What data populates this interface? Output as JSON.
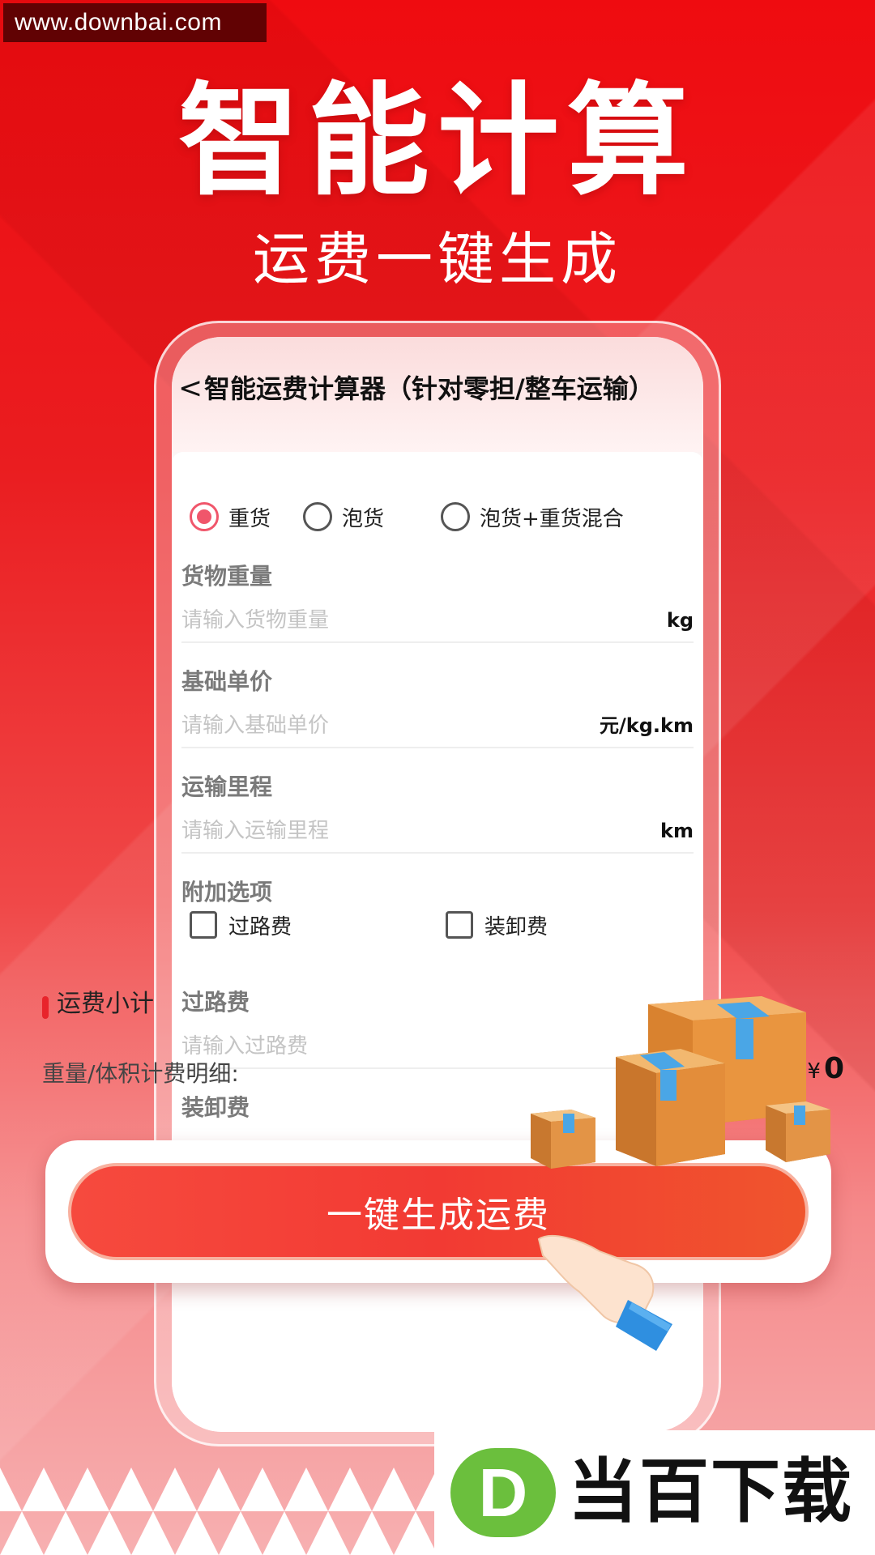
{
  "watermark": "www.downbai.com",
  "hero": {
    "title": "智能计算",
    "subtitle": "运费一键生成"
  },
  "app": {
    "nav_title": "智能运费计算器（针对零担/整车运输）",
    "back_glyph": "<",
    "cargo_types": [
      {
        "label": "重货",
        "checked": true
      },
      {
        "label": "泡货",
        "checked": false
      },
      {
        "label": "泡货+重货混合",
        "checked": false
      }
    ],
    "fields": [
      {
        "label": "货物重量",
        "placeholder": "请输入货物重量",
        "unit": "kg"
      },
      {
        "label": "基础单价",
        "placeholder": "请输入基础单价",
        "unit": "元/kg.km"
      },
      {
        "label": "运输里程",
        "placeholder": "请输入运输里程",
        "unit": "km"
      }
    ],
    "extras": {
      "label": "附加选项",
      "options": [
        {
          "label": "过路费",
          "checked": false
        },
        {
          "label": "装卸费",
          "checked": false
        }
      ]
    },
    "toll_field": {
      "label": "过路费",
      "placeholder": "请输入过路费"
    },
    "loading_field": {
      "label": "装卸费"
    },
    "summary": {
      "title": "运费小计",
      "detail_label": "重量/体积计费明细:",
      "currency": "¥",
      "amount": "0"
    }
  },
  "cta": {
    "label": "一键生成运费"
  },
  "brand": {
    "logo_letter": "D",
    "name": "当百下载"
  },
  "colors": {
    "primary_red": "#ea1d20",
    "accent_pink": "#f0566b",
    "brand_green": "#6bbf3d"
  }
}
